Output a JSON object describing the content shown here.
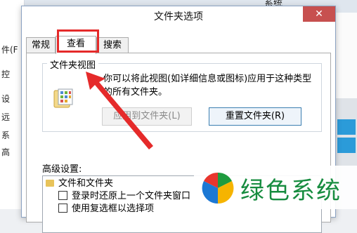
{
  "background_window": {
    "title_fragment": "系统",
    "left_fragments": [
      "件(F",
      "控",
      "设",
      "远",
      "系",
      "高"
    ]
  },
  "dialog": {
    "title": "文件夹选项",
    "close_glyph": "✕",
    "tabs": [
      {
        "label": "常规",
        "selected": false
      },
      {
        "label": "查看",
        "selected": true
      },
      {
        "label": "搜索",
        "selected": false
      }
    ],
    "folder_views": {
      "legend": "文件夹视图",
      "description": "你可以将此视图(如详细信息或图标)应用于这种类型的所有文件夹。",
      "apply_button": "应用到文件夹(L)",
      "reset_button": "重置文件夹(R)"
    },
    "advanced": {
      "label": "高级设置:",
      "items": [
        {
          "type": "folder",
          "label": "文件和文件夹"
        },
        {
          "type": "checkbox",
          "label": "登录时还原上一个文件夹窗口",
          "checked": false
        },
        {
          "type": "checkbox",
          "label": "使用复选框以选择项",
          "checked": false
        }
      ]
    }
  },
  "annotation": {
    "color": "#e52a2a"
  },
  "watermark": {
    "text": "绿色系统"
  }
}
